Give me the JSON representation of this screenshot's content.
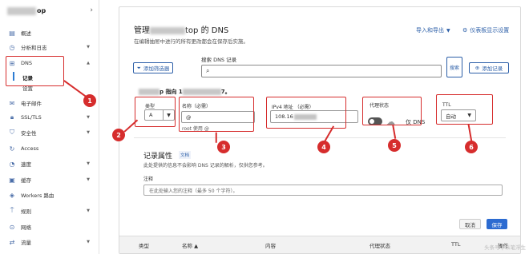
{
  "sidebar": {
    "site_name": "op",
    "items": [
      {
        "label": "概述",
        "icon": "document-icon"
      },
      {
        "label": "分析和日志",
        "icon": "clock-icon"
      },
      {
        "label": "DNS",
        "icon": "network-icon"
      },
      {
        "label": "记录",
        "sub": true
      },
      {
        "label": "设置",
        "sub": true
      },
      {
        "label": "电子邮件",
        "icon": "email-icon"
      },
      {
        "label": "SSL/TLS",
        "icon": "lock-icon"
      },
      {
        "label": "安全性",
        "icon": "shield-icon"
      },
      {
        "label": "Access",
        "icon": "access-icon"
      },
      {
        "label": "速度",
        "icon": "speed-icon"
      },
      {
        "label": "缓存",
        "icon": "cache-icon"
      },
      {
        "label": "Workers 路由",
        "icon": "workers-icon"
      },
      {
        "label": "规则",
        "icon": "rules-icon"
      },
      {
        "label": "网络",
        "icon": "location-icon"
      },
      {
        "label": "流量",
        "icon": "traffic-icon"
      }
    ]
  },
  "header": {
    "title_prefix": "管理",
    "title_suffix": "top 的 DNS",
    "subtitle": "在编辑抽屉中进行的所有更改都会在保存后实施。",
    "import_export": "导入和导出",
    "dashboard_settings": "仪表板显示设置"
  },
  "toolbar": {
    "add_filter": "添加筛选器",
    "search_label": "搜索 DNS 记录",
    "search_button": "搜索",
    "add_record": "添加记录"
  },
  "record": {
    "points_prefix": "p 指向 1",
    "points_suffix": "7。",
    "type_label": "类型",
    "type_value": "A",
    "name_label": "名称（必需）",
    "name_value": "@",
    "name_helper": "root 使用 @",
    "ipv4_label": "IPv4 地址 （必需）",
    "ipv4_value": "108.16",
    "proxy_label": "代理状态",
    "proxy_text": "仅 DNS",
    "ttl_label": "TTL",
    "ttl_value": "自动"
  },
  "attributes": {
    "title": "记录属性",
    "docs_link": "文档",
    "desc": "此处提供的信息不会影响 DNS 记录的解析，仅供您参考。",
    "note_label": "注释",
    "note_placeholder": "在此处输入您的注释（最多 50 个字符）。"
  },
  "actions": {
    "cancel": "取消",
    "save": "保存"
  },
  "table": {
    "columns": [
      "类型",
      "名称 ▲",
      "内容",
      "代理状态",
      "TTL",
      "操作"
    ]
  },
  "annotations": [
    "1",
    "2",
    "3",
    "4",
    "5",
    "6"
  ],
  "watermark": "头条号 | 纵笔浮生",
  "colors": {
    "accent": "#2c6bd1",
    "annotation": "#d62d2d"
  }
}
